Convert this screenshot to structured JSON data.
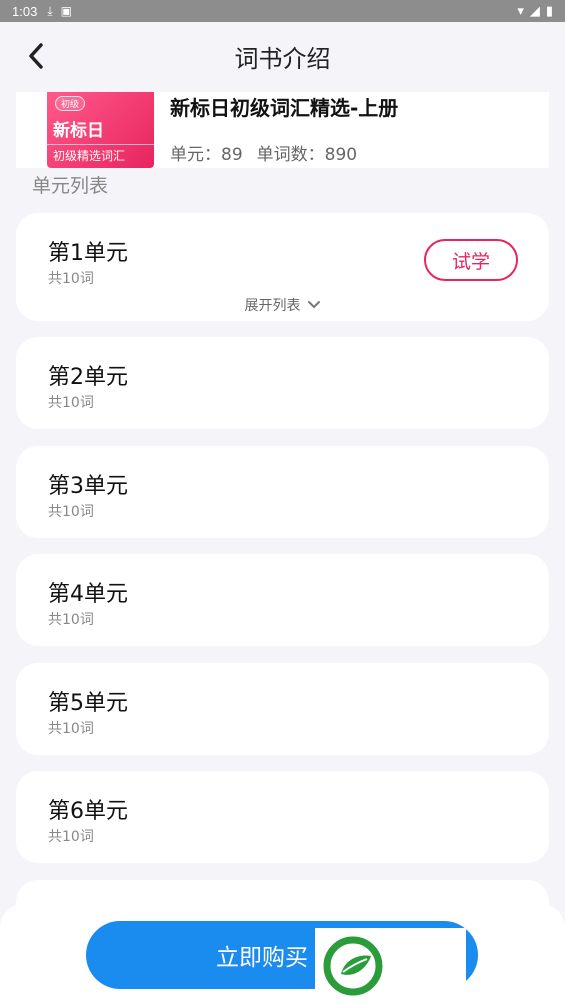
{
  "status_bar": {
    "time": "1:03"
  },
  "header": {
    "title": "词书介绍"
  },
  "book": {
    "cover_tag": "初级",
    "cover_title": "新标日",
    "cover_sub": "初级精选词汇",
    "title": "新标日初级词汇精选-上册",
    "units_label": "单元：89",
    "words_label": "单词数：890"
  },
  "section_label": "单元列表",
  "units": [
    {
      "name": "第1单元",
      "count": "共10词",
      "try_label": "试学",
      "expand_label": "展开列表"
    },
    {
      "name": "第2单元",
      "count": "共10词"
    },
    {
      "name": "第3单元",
      "count": "共10词"
    },
    {
      "name": "第4单元",
      "count": "共10词"
    },
    {
      "name": "第5单元",
      "count": "共10词"
    },
    {
      "name": "第6单元",
      "count": "共10词"
    }
  ],
  "buy_button": "立即购买",
  "colors": {
    "accent_pink": "#e8245e",
    "accent_blue": "#1a8cf0",
    "logo_green": "#2a9d3a"
  }
}
